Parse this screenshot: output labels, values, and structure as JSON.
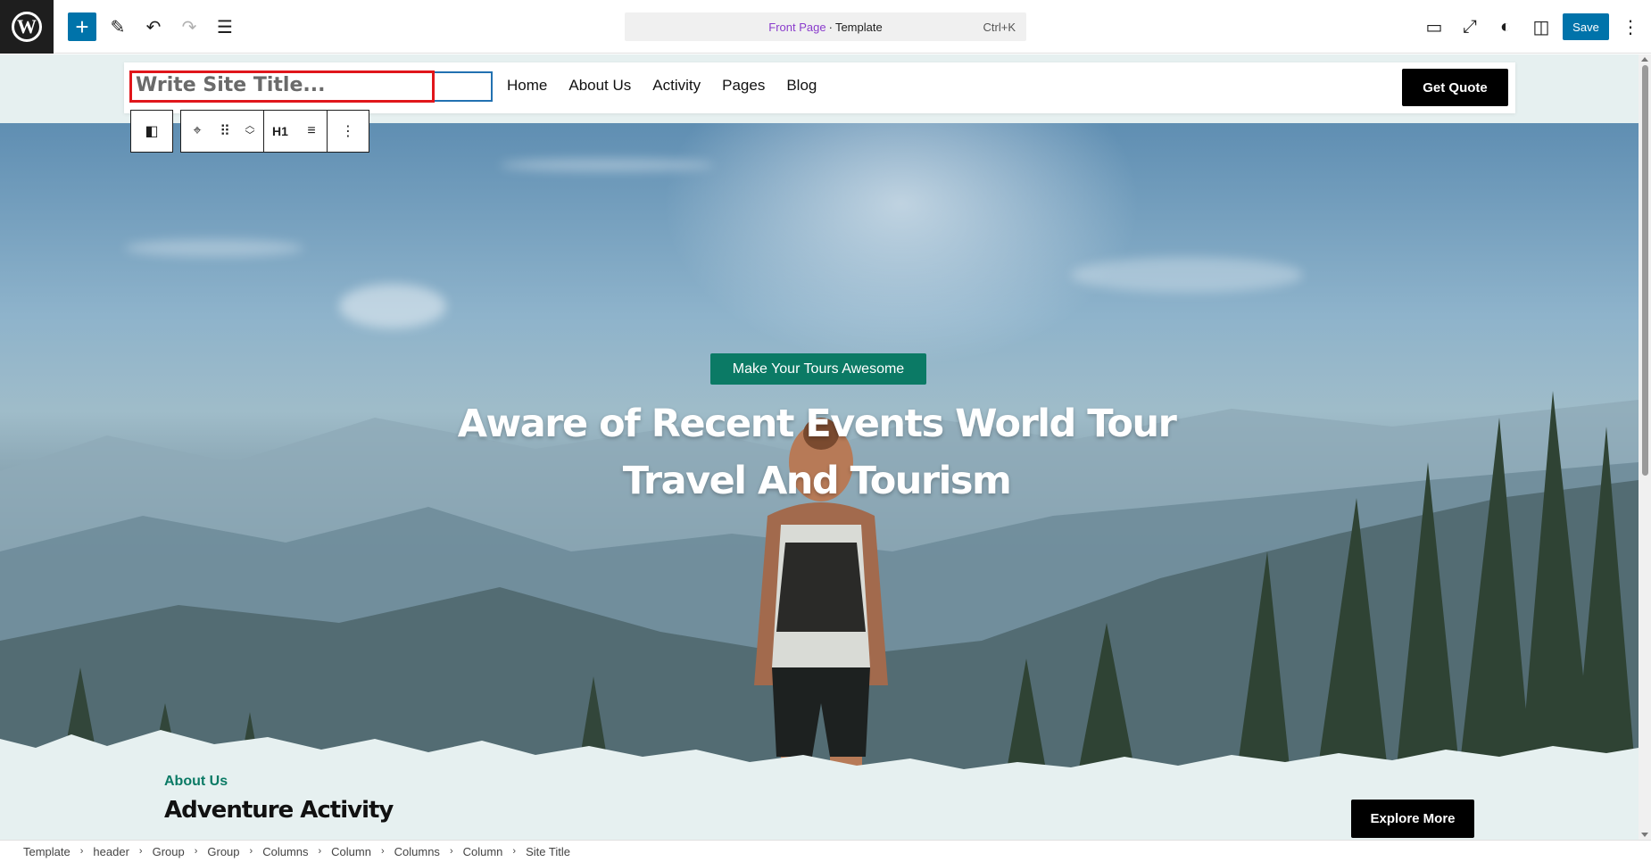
{
  "toolbar": {
    "logo": "W",
    "add_icon": "+",
    "tools_icon": "✎",
    "undo_icon": "↶",
    "redo_icon": "↷",
    "outline_icon": "☰",
    "command": {
      "page": "Front Page",
      "separator": "·",
      "type": "Template",
      "shortcut": "Ctrl+K"
    },
    "view_icon": "▭",
    "fullscreen_icon": "⤢",
    "styles_icon": "◐",
    "settings_icon": "◫",
    "save_label": "Save",
    "options_icon": "⋮"
  },
  "site_header": {
    "title_placeholder": "Write Site Title...",
    "nav": [
      "Home",
      "About Us",
      "Activity",
      "Pages",
      "Blog"
    ],
    "cta": "Get Quote"
  },
  "block_toolbar": {
    "parent_icon": "◧",
    "location_icon": "⌖",
    "drag_icon": "⠿",
    "move_up_icon": "︿",
    "move_down_icon": "﹀",
    "heading_level": "H1",
    "align_icon": "≡",
    "more_icon": "⋮"
  },
  "hero": {
    "badge": "Make Your Tours Awesome",
    "title": "Aware of Recent Events World Tour Travel And Tourism"
  },
  "about": {
    "label": "About Us",
    "title": "Adventure Activity",
    "button": "Explore More"
  },
  "breadcrumb": [
    "Template",
    "header",
    "Group",
    "Group",
    "Columns",
    "Column",
    "Columns",
    "Column",
    "Site Title"
  ],
  "colors": {
    "accent": "#0b7a65",
    "wp_blue": "#0073aa",
    "highlight": "#e0161b"
  }
}
